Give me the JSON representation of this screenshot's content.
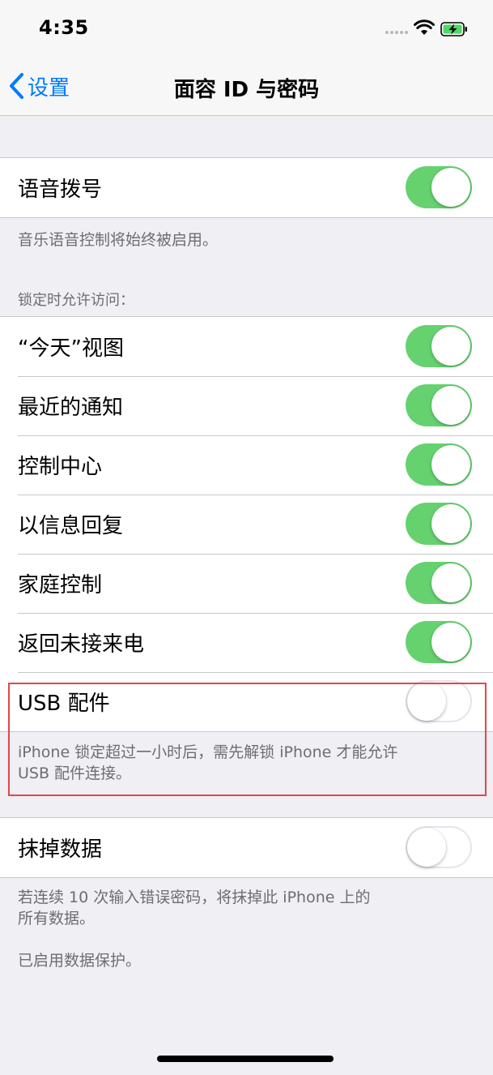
{
  "status_bar": {
    "time": "4:35"
  },
  "nav": {
    "back_label": "设置",
    "title": "面容 ID 与密码"
  },
  "voice_dial": {
    "label": "语音拨号",
    "on": true,
    "footer": "音乐语音控制将始终被启用。"
  },
  "lock_access": {
    "header": "锁定时允许访问：",
    "items": [
      {
        "label": "“今天”视图",
        "on": true
      },
      {
        "label": "最近的通知",
        "on": true
      },
      {
        "label": "控制中心",
        "on": true
      },
      {
        "label": "以信息回复",
        "on": true
      },
      {
        "label": "家庭控制",
        "on": true
      },
      {
        "label": "返回未接来电",
        "on": true
      },
      {
        "label": "USB 配件",
        "on": false
      }
    ],
    "footer_line1": "iPhone 锁定超过一小时后，需先解锁 iPhone 才能允许",
    "footer_line2": "USB 配件连接。"
  },
  "erase_data": {
    "label": "抹掉数据",
    "on": false,
    "footer_line1": "若连续 10 次输入错误密码，将抹掉此 iPhone 上的",
    "footer_line2": "所有数据。",
    "footer_note": "已启用数据保护。"
  },
  "colors": {
    "accent": "#007aff",
    "toggle_on": "#65d26f",
    "highlight": "#e0474c",
    "battery": "#4cd964"
  },
  "icons": [
    "back-chevron-icon",
    "signal-icon",
    "wifi-icon",
    "battery-charging-icon"
  ]
}
